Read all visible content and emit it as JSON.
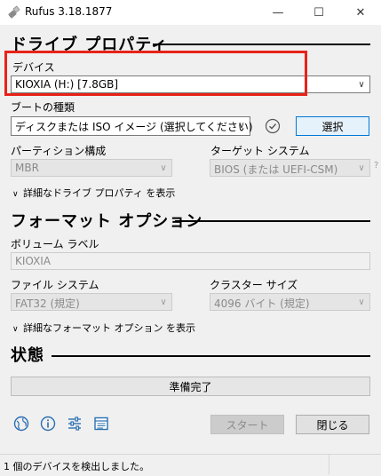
{
  "window": {
    "title": "Rufus 3.18.1877",
    "minimize_glyph": "—",
    "maximize_glyph": "☐",
    "close_glyph": "✕"
  },
  "drive_properties": {
    "title": "ドライブ プロパティ",
    "device_label": "デバイス",
    "device_value": "KIOXIA (H:) [7.8GB]",
    "boot_label": "ブートの種類",
    "boot_value": "ディスクまたは ISO イメージ (選択してください)",
    "select_button": "選択",
    "partition_label": "パーティション構成",
    "partition_value": "MBR",
    "target_label": "ターゲット システム",
    "target_value": "BIOS (または UEFI-CSM)",
    "help_glyph": "?",
    "advanced_toggle": "詳細なドライブ プロパティ を表示"
  },
  "format_options": {
    "title": "フォーマット オプション",
    "volume_label": "ボリューム ラベル",
    "volume_value": "KIOXIA",
    "filesystem_label": "ファイル システム",
    "filesystem_value": "FAT32 (規定)",
    "cluster_label": "クラスター サイズ",
    "cluster_value": "4096 バイト (規定)",
    "advanced_toggle": "詳細なフォーマット オプション を表示"
  },
  "status": {
    "title": "状態",
    "progress_text": "準備完了",
    "progress_fraction": 0
  },
  "toolbar": {
    "icons": [
      "globe-icon",
      "info-icon",
      "settings-sliders-icon",
      "log-icon"
    ],
    "start_button": "スタート",
    "close_button": "閉じる"
  },
  "statusbar": {
    "text": "1 個のデバイスを検出しました。"
  },
  "colors": {
    "highlight": "#e8231a",
    "accent": "#0078d7"
  }
}
